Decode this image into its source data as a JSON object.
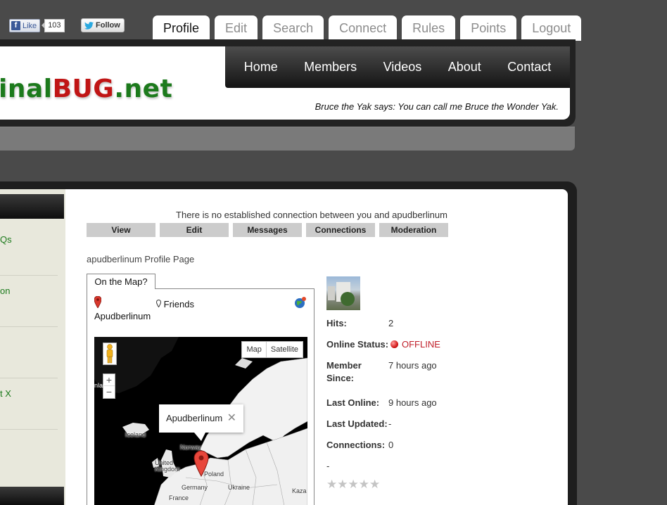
{
  "social": {
    "like_label": "Like",
    "like_count": "103",
    "follow_label": "Follow"
  },
  "top_tabs": [
    {
      "label": "Profile",
      "active": true
    },
    {
      "label": "Edit"
    },
    {
      "label": "Search"
    },
    {
      "label": "Connect"
    },
    {
      "label": "Rules"
    },
    {
      "label": "Points"
    },
    {
      "label": "Logout"
    }
  ],
  "logo": {
    "part1": "inal",
    "part2": "BUG",
    "part3": ".net"
  },
  "main_nav": [
    "Home",
    "Members",
    "Videos",
    "About",
    "Contact"
  ],
  "tagline": "Bruce the Yak says: You can call me Bruce the Wonder Yak.",
  "sidebar": {
    "items": [
      "Qs",
      "on",
      "",
      "t X",
      ""
    ]
  },
  "profile": {
    "connection_message": "There is no established connection between you and apudberlinum",
    "actions": [
      "View",
      "Edit",
      "Messages",
      "Connections",
      "Moderation"
    ],
    "page_label": "apudberlinum Profile Page"
  },
  "map": {
    "tab_label": "On the Map?",
    "legend_self": "Apudberlinum",
    "legend_friends": "Friends",
    "type_map": "Map",
    "type_satellite": "Satellite",
    "zoom_in": "+",
    "zoom_out": "−",
    "infowindow_text": "Apudberlinum",
    "infowindow_close": "✕",
    "labels": {
      "iceland": "Iceland",
      "norway": "Norway",
      "uk": "United Kingdom",
      "poland": "Poland",
      "germany": "Germany",
      "ukraine": "Ukraine",
      "france": "France",
      "kaza": "Kaza",
      "greenland": "nlar"
    }
  },
  "details": {
    "hits_label": "Hits:",
    "hits_value": "2",
    "status_label": "Online Status:",
    "status_value": "OFFLINE",
    "member_label_1": "Member",
    "member_label_2": "Since:",
    "member_value": "7 hours ago",
    "last_online_label": "Last Online:",
    "last_online_value": "9 hours ago",
    "last_updated_label": "Last Updated:",
    "last_updated_value": "-",
    "connections_label": "Connections:",
    "connections_value": "0",
    "dash": "-",
    "rating_stars": 0,
    "rating_max": 5
  },
  "colors": {
    "accent_green": "#1c7a1c",
    "accent_red": "#c01515",
    "offline": "#c0202a"
  }
}
